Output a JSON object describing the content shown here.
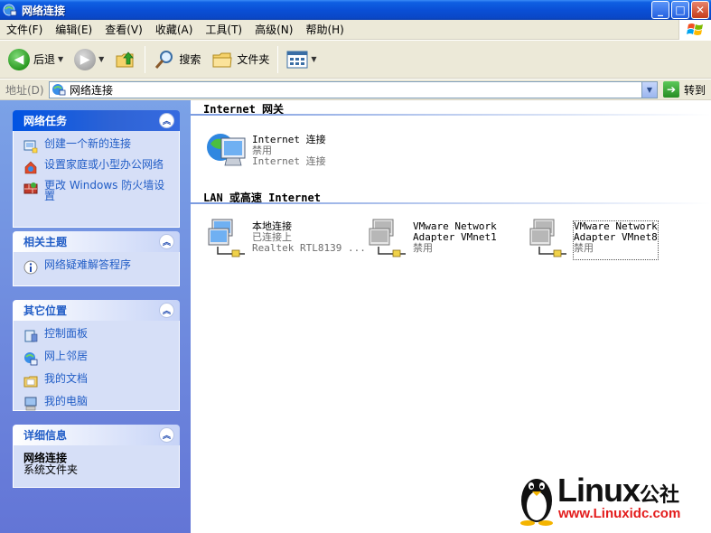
{
  "window": {
    "title": "网络连接",
    "buttons": {
      "minimize": "_",
      "maximize": "□",
      "close": "✕"
    }
  },
  "menu": [
    "文件(F)",
    "编辑(E)",
    "查看(V)",
    "收藏(A)",
    "工具(T)",
    "高级(N)",
    "帮助(H)"
  ],
  "toolbar": {
    "back_label": "后退",
    "search_label": "搜索",
    "folders_label": "文件夹"
  },
  "address": {
    "label": "地址(D)",
    "value": "网络连接",
    "go_label": "转到"
  },
  "sidebar": {
    "network_tasks": {
      "title": "网络任务",
      "items": [
        {
          "label": "创建一个新的连接",
          "icon": "new-connection-icon"
        },
        {
          "label": "设置家庭或小型办公网络",
          "icon": "home-network-icon"
        },
        {
          "label": "更改 Windows 防火墙设置",
          "icon": "firewall-icon"
        }
      ]
    },
    "related_topics": {
      "title": "相关主题",
      "items": [
        {
          "label": "网络疑难解答程序",
          "icon": "info-icon"
        }
      ]
    },
    "other_places": {
      "title": "其它位置",
      "items": [
        {
          "label": "控制面板",
          "icon": "control-panel-icon"
        },
        {
          "label": "网上邻居",
          "icon": "network-places-icon"
        },
        {
          "label": "我的文档",
          "icon": "my-documents-icon"
        },
        {
          "label": "我的电脑",
          "icon": "my-computer-icon"
        }
      ]
    },
    "details": {
      "title": "详细信息",
      "name": "网络连接",
      "type": "系统文件夹"
    }
  },
  "main": {
    "groups": [
      {
        "header": "Internet 网关",
        "connections": [
          {
            "name": "Internet 连接",
            "status": "禁用",
            "device": "Internet 连接"
          }
        ]
      },
      {
        "header": "LAN 或高速 Internet",
        "connections": [
          {
            "name": "本地连接",
            "status": "已连接上",
            "device": "Realtek RTL8139 ..."
          },
          {
            "name": "VMware Network Adapter VMnet1",
            "line1": "VMware Network",
            "line2": "Adapter VMnet1",
            "status": "禁用"
          },
          {
            "name": "VMware Network Adapter VMnet8",
            "line1": "VMware Network",
            "line2": "Adapter VMnet8",
            "status": "禁用"
          }
        ]
      }
    ]
  },
  "watermark": {
    "brand": "Linux",
    "suffix": "公社",
    "url": "www.Linuxidc.com"
  }
}
